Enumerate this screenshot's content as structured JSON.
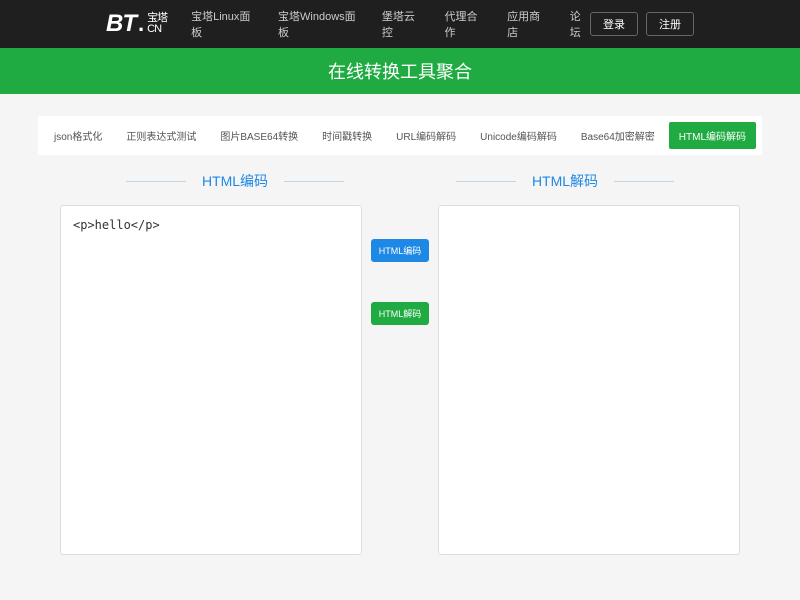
{
  "logo": {
    "bt": "BT",
    "dot": ".",
    "sub1": "宝塔",
    "sub2": "CN"
  },
  "nav": [
    "宝塔Linux面板",
    "宝塔Windows面板",
    "堡塔云控",
    "代理合作",
    "应用商店",
    "论坛"
  ],
  "auth": {
    "login": "登录",
    "register": "注册"
  },
  "banner": "在线转换工具聚合",
  "tabs": [
    "json格式化",
    "正则表达式测试",
    "图片BASE64转换",
    "时间戳转换",
    "URL编码解码",
    "Unicode编码解码",
    "Base64加密解密",
    "HTML编码解码"
  ],
  "activeTab": 7,
  "sections": {
    "left": "HTML编码",
    "right": "HTML解码"
  },
  "buttons": {
    "encode": "HTML编码",
    "decode": "HTML解码"
  },
  "input": "<p>hello</p>",
  "output": ""
}
